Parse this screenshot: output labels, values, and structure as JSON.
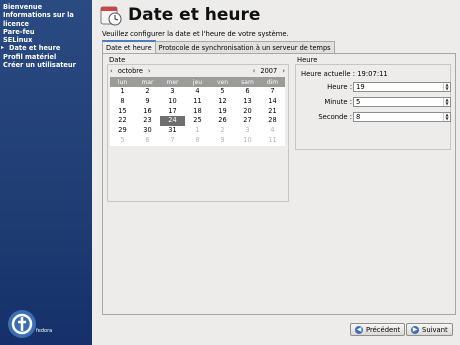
{
  "sidebar": {
    "items": [
      {
        "label": "Bienvenue"
      },
      {
        "label": "Informations sur la licence"
      },
      {
        "label": "Pare-feu"
      },
      {
        "label": "SELinux"
      },
      {
        "label": "Date et heure",
        "current": true
      },
      {
        "label": "Profil matériel"
      },
      {
        "label": "Créer un utilisateur"
      }
    ],
    "logo": {
      "icon": "fedora-logo-icon",
      "text": "fedora"
    }
  },
  "header": {
    "title": "Date et heure",
    "subtitle": "Veuillez configurer la date et l'heure de votre système.",
    "icon": "clock-calendar-icon"
  },
  "tabs": [
    {
      "label": "Date et heure",
      "active": true
    },
    {
      "label": "Protocole de synchronisation à un serveur de temps",
      "active": false
    }
  ],
  "date": {
    "frame_label": "Date",
    "month": "octobre",
    "year": "2007",
    "weekdays": [
      "lun",
      "mar",
      "mer",
      "jeu",
      "ven",
      "sam",
      "dim"
    ],
    "weeks": [
      [
        "1",
        "2",
        "3",
        "4",
        "5",
        "6",
        "7"
      ],
      [
        "8",
        "9",
        "10",
        "11",
        "12",
        "13",
        "14"
      ],
      [
        "15",
        "16",
        "17",
        "18",
        "19",
        "20",
        "21"
      ],
      [
        "22",
        "23",
        "24",
        "25",
        "26",
        "27",
        "28"
      ],
      [
        "29",
        "30",
        "31",
        "1",
        "2",
        "3",
        "4"
      ],
      [
        "5",
        "6",
        "7",
        "8",
        "9",
        "10",
        "11"
      ]
    ],
    "selected_day": "24"
  },
  "time": {
    "frame_label": "Heure",
    "current_label": "Heure actuelle :",
    "current_value": "19:07:11",
    "hour_label": "Heure :",
    "hour_value": "19",
    "minute_label": "Minute :",
    "minute_value": "5",
    "second_label": "Seconde :",
    "second_value": "8"
  },
  "footer": {
    "back_label": "Précédent",
    "next_label": "Suivant"
  },
  "colors": {
    "sidebar_bg": "#1f3d73",
    "tab_accent": "#4a7cc2",
    "selected_day_bg": "#6e6e6c"
  }
}
